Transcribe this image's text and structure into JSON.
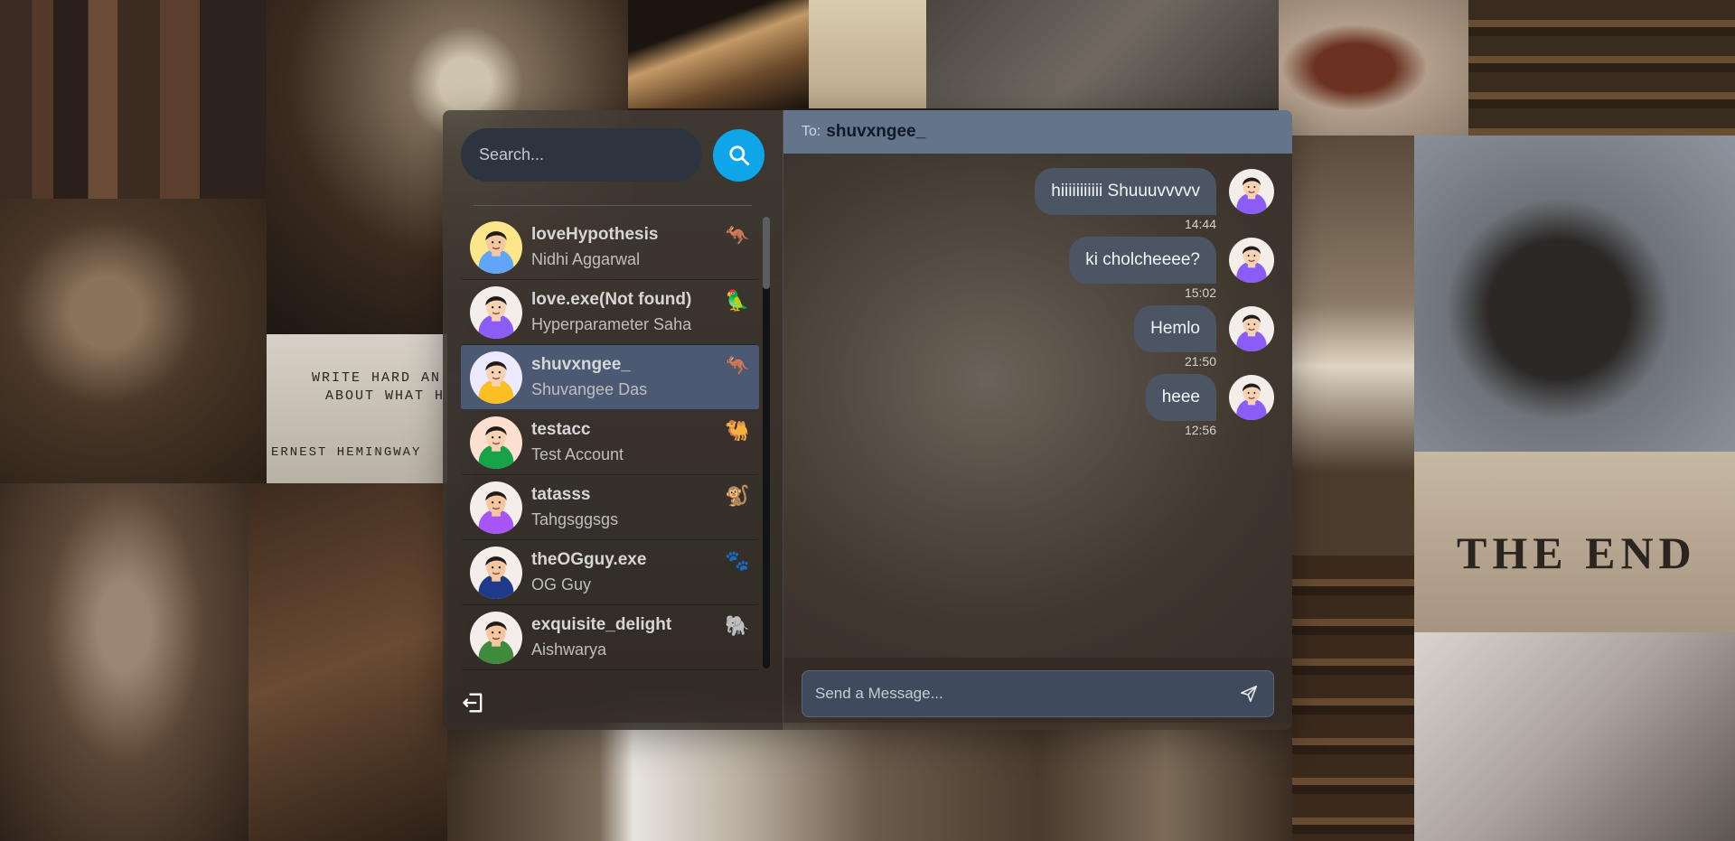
{
  "background": {
    "hemingway_line1": "WRITE HARD AN",
    "hemingway_line2": "ABOUT WHAT H",
    "hemingway_author": "ERNEST HEMINGWAY",
    "end_text": "THE END"
  },
  "sidebar": {
    "search": {
      "placeholder": "Search...",
      "button_icon": "search-icon"
    },
    "conversations": [
      {
        "username": "loveHypothesis",
        "fullname": "Nidhi Aggarwal",
        "emoji": "🦘",
        "avatar_shirt": "#60a5fa",
        "avatar_skin": "#f4c7a1",
        "avatar_bg": "#fde68a",
        "selected": false
      },
      {
        "username": "love.exe(Not found)",
        "fullname": "Hyperparameter Saha",
        "emoji": "🦜",
        "avatar_shirt": "#8b5cf6",
        "avatar_skin": "#f6d2b3",
        "avatar_bg": "#f3eee9",
        "selected": false
      },
      {
        "username": "shuvxngee_",
        "fullname": "Shuvangee Das",
        "emoji": "🦘",
        "avatar_shirt": "#fbbf24",
        "avatar_skin": "#f6d2b3",
        "avatar_bg": "#ede9fe",
        "selected": true
      },
      {
        "username": "testacc",
        "fullname": "Test Account",
        "emoji": "🐫",
        "avatar_shirt": "#16a34a",
        "avatar_skin": "#f6d2b3",
        "avatar_bg": "#fde0d0",
        "selected": false
      },
      {
        "username": "tatasss",
        "fullname": "Tahgsggsgs",
        "emoji": "🐒",
        "avatar_shirt": "#a855f7",
        "avatar_skin": "#f4c7a1",
        "avatar_bg": "#f3eee9",
        "selected": false
      },
      {
        "username": "theOGguy.exe",
        "fullname": "OG Guy",
        "emoji": "🐾",
        "avatar_shirt": "#1e3a8a",
        "avatar_skin": "#f4c7a1",
        "avatar_bg": "#f3eee9",
        "selected": false
      },
      {
        "username": "exquisite_delight",
        "fullname": "Aishwarya",
        "emoji": "🐘",
        "avatar_shirt": "#3f8a3c",
        "avatar_skin": "#f4c7a1",
        "avatar_bg": "#f3eee9",
        "selected": false
      }
    ],
    "logout_icon": "logout-icon"
  },
  "chat": {
    "header": {
      "to_label": "To:",
      "recipient": "shuvxngee_"
    },
    "messages": [
      {
        "text": "hiiiiiiiiiii Shuuuvvvvv",
        "time": "14:44"
      },
      {
        "text": "ki cholcheeee?",
        "time": "15:02"
      },
      {
        "text": "Hemlo",
        "time": "21:50"
      },
      {
        "text": "heee",
        "time": "12:56"
      }
    ],
    "composer": {
      "placeholder": "Send a Message...",
      "send_icon": "send-icon"
    }
  },
  "colors": {
    "search_button": "#0ea5e9",
    "selected_conversation": "#4b5a72",
    "chat_header": "#64748b",
    "bubble": "#4b5563"
  }
}
